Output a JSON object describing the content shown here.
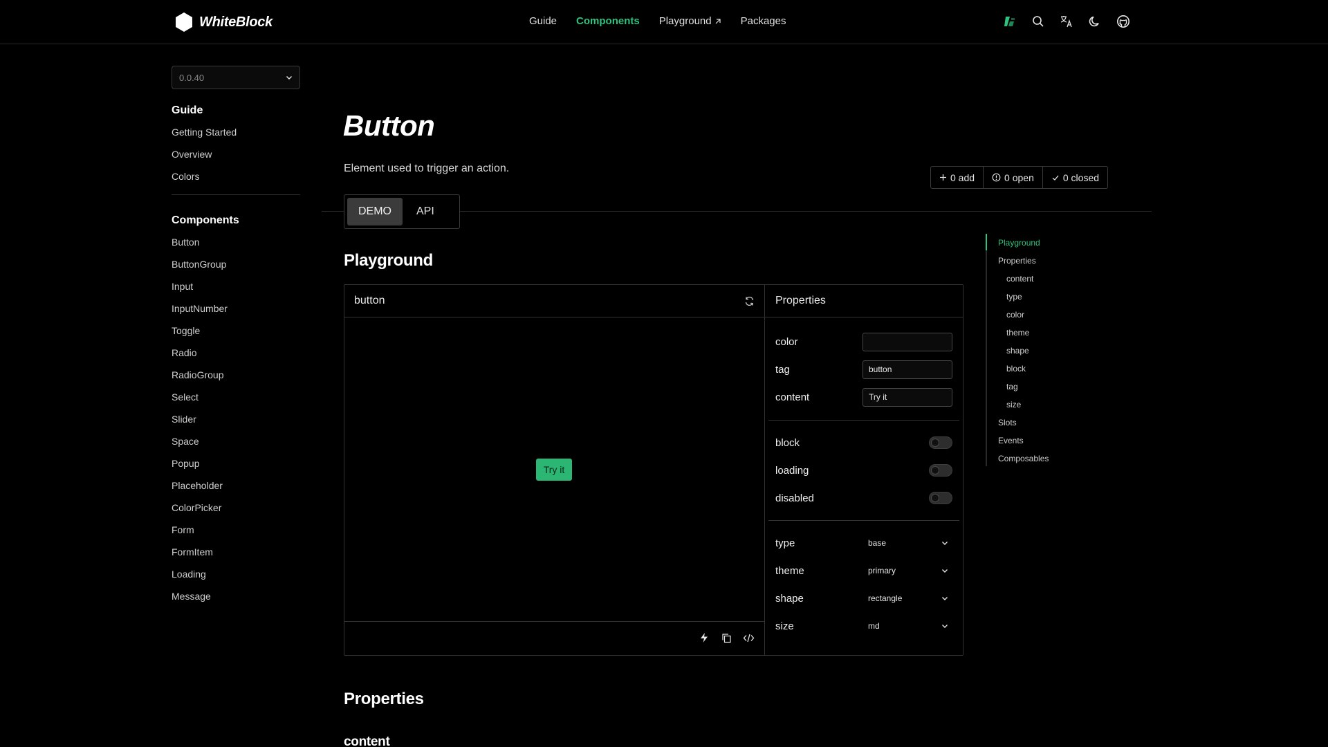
{
  "app": {
    "logo_text": "WhiteBlock",
    "accent_color": "#2ec27e"
  },
  "topnav": {
    "items": [
      {
        "label": "Guide",
        "active": false
      },
      {
        "label": "Components",
        "active": true
      },
      {
        "label": "Playground",
        "active": false,
        "external": true
      },
      {
        "label": "Packages",
        "active": false
      }
    ],
    "icons": [
      "logo-alt-icon",
      "search-icon",
      "translate-icon",
      "moon-icon",
      "github-icon"
    ]
  },
  "sidebar": {
    "version": "0.0.40",
    "groups": [
      {
        "title": "Guide",
        "items": [
          "Getting Started",
          "Overview",
          "Colors"
        ]
      },
      {
        "title": "Components",
        "items": [
          "Button",
          "ButtonGroup",
          "Input",
          "InputNumber",
          "Toggle",
          "Radio",
          "RadioGroup",
          "Select",
          "Slider",
          "Space",
          "Popup",
          "Placeholder",
          "ColorPicker",
          "Form",
          "FormItem",
          "Loading",
          "Message"
        ]
      }
    ]
  },
  "page": {
    "title": "Button",
    "description": "Element used to trigger an action.",
    "issues": {
      "add": "0 add",
      "open": "0 open",
      "closed": "0 closed"
    },
    "tabs": [
      "DEMO",
      "API"
    ],
    "active_tab": "DEMO"
  },
  "playground": {
    "section_title": "Playground",
    "component_name": "button",
    "preview_button": "Try it",
    "preview_color": "#2bb673",
    "properties_title": "Properties",
    "inputs": [
      {
        "label": "color",
        "value": ""
      },
      {
        "label": "tag",
        "value": "button"
      },
      {
        "label": "content",
        "value": "Try it"
      }
    ],
    "toggles": [
      {
        "label": "block",
        "on": false
      },
      {
        "label": "loading",
        "on": false
      },
      {
        "label": "disabled",
        "on": false
      }
    ],
    "selects": [
      {
        "label": "type",
        "value": "base"
      },
      {
        "label": "theme",
        "value": "primary"
      },
      {
        "label": "shape",
        "value": "rectangle"
      },
      {
        "label": "size",
        "value": "md"
      }
    ]
  },
  "sections_below": {
    "properties_title": "Properties",
    "first_prop": "content"
  },
  "toc": {
    "items": [
      {
        "label": "Playground",
        "level": 0,
        "active": true
      },
      {
        "label": "Properties",
        "level": 0,
        "active": false
      },
      {
        "label": "content",
        "level": 1,
        "active": false
      },
      {
        "label": "type",
        "level": 1,
        "active": false
      },
      {
        "label": "color",
        "level": 1,
        "active": false
      },
      {
        "label": "theme",
        "level": 1,
        "active": false
      },
      {
        "label": "shape",
        "level": 1,
        "active": false
      },
      {
        "label": "block",
        "level": 1,
        "active": false
      },
      {
        "label": "tag",
        "level": 1,
        "active": false
      },
      {
        "label": "size",
        "level": 1,
        "active": false
      },
      {
        "label": "Slots",
        "level": 0,
        "active": false
      },
      {
        "label": "Events",
        "level": 0,
        "active": false
      },
      {
        "label": "Composables",
        "level": 0,
        "active": false
      }
    ]
  }
}
